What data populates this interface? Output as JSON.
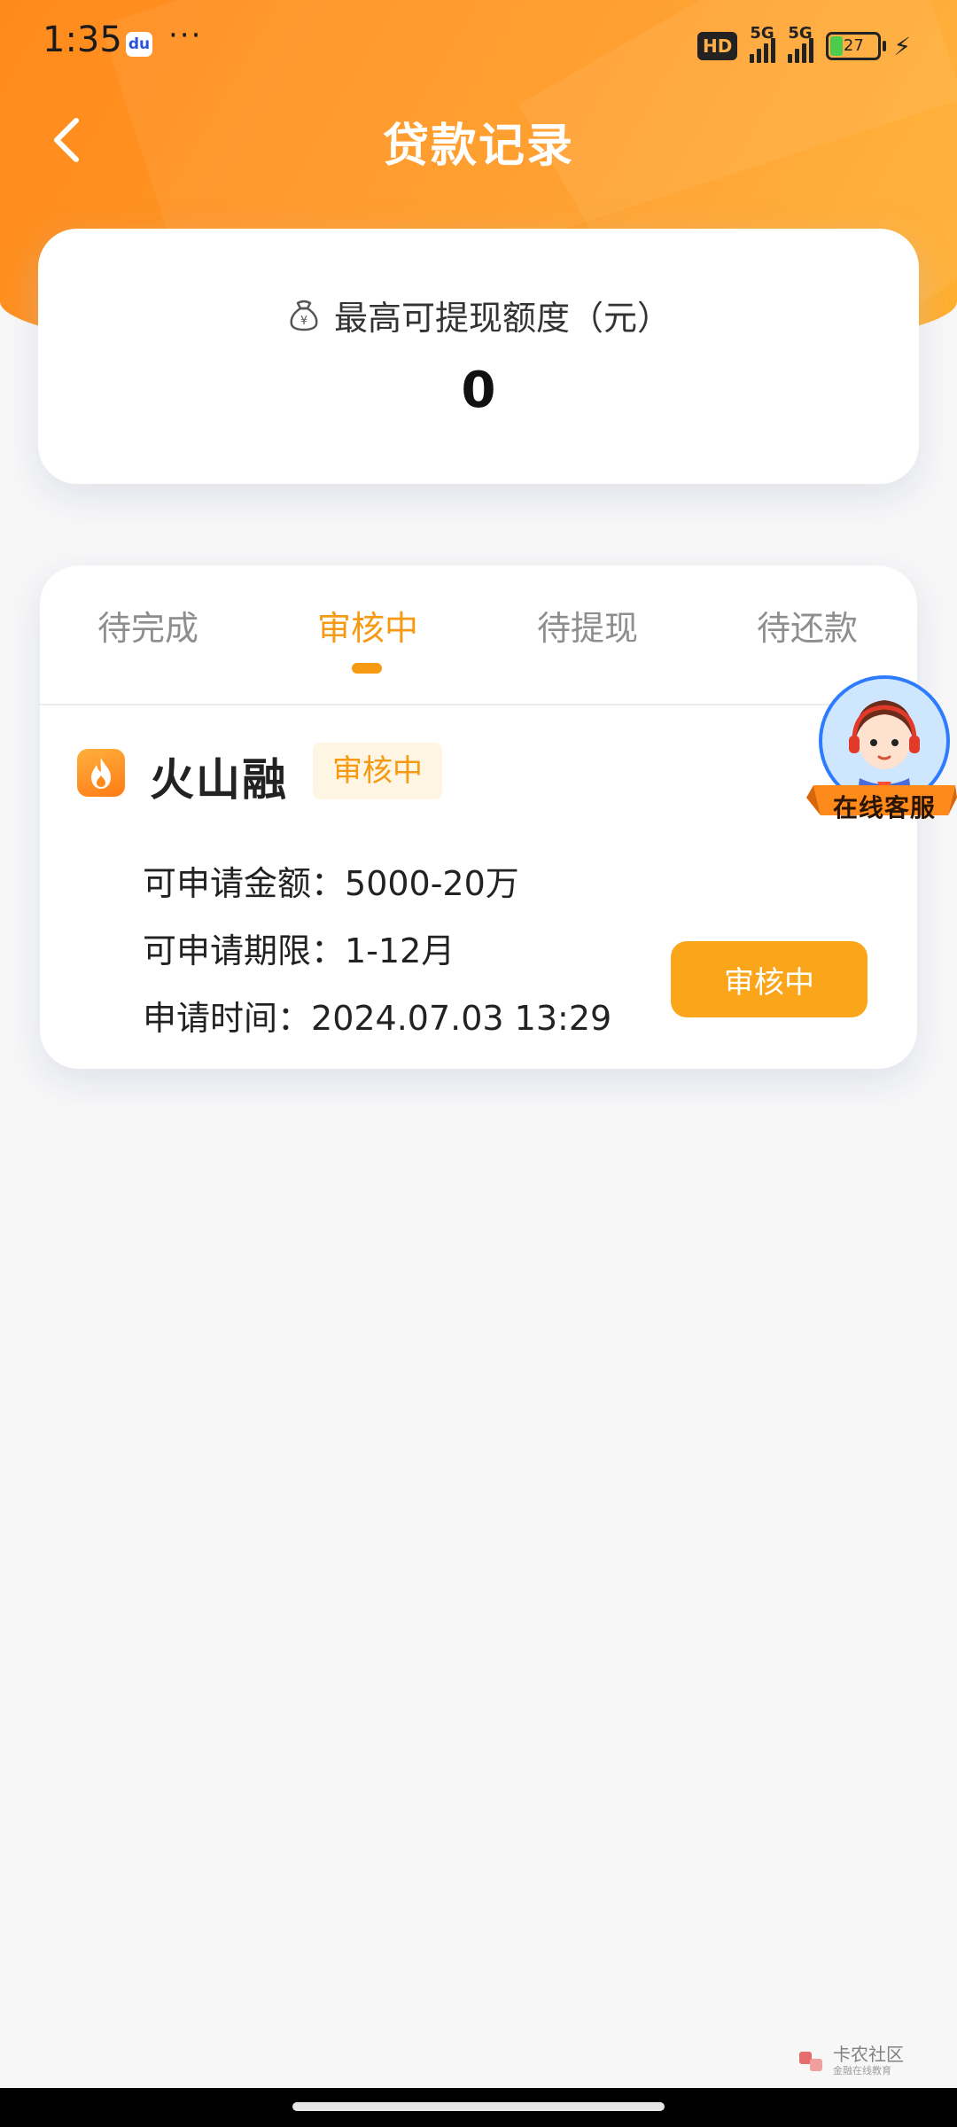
{
  "status_bar": {
    "time": "1:35",
    "more": "···",
    "network_badge": "HD",
    "signal_1": "5G",
    "signal_2": "5G",
    "battery": "27",
    "colors": {
      "icon": "#222222"
    }
  },
  "nav": {
    "title": "贷款记录",
    "back_icon": "chevron-left-icon"
  },
  "quota": {
    "icon": "money-bag-icon",
    "label": "最高可提现额度（元）",
    "value": "0"
  },
  "tabs": [
    {
      "label": "待完成",
      "active": false
    },
    {
      "label": "审核中",
      "active": true
    },
    {
      "label": "待提现",
      "active": false
    },
    {
      "label": "待还款",
      "active": false
    }
  ],
  "record": {
    "brand_icon": "flame-icon",
    "brand_name": "火山融",
    "status_tag": "审核中",
    "amount_label": "可申请金额：",
    "amount_value": "5000-20万",
    "term_label": "可申请期限：",
    "term_value": "1-12月",
    "time_label": "申请时间：",
    "time_value": "2024.07.03 13:29",
    "action_label": "审核中"
  },
  "customer_service": {
    "label": "在线客服",
    "icon": "customer-service-avatar-icon"
  },
  "watermark": {
    "text": "卡农社区",
    "sub": "金融在线教育"
  },
  "colors": {
    "accent": "#f59a12",
    "header_gradient_start": "#ff8a1c",
    "header_gradient_end": "#ffb030",
    "button": "#fba51a",
    "tag_bg": "#fff5e3"
  }
}
